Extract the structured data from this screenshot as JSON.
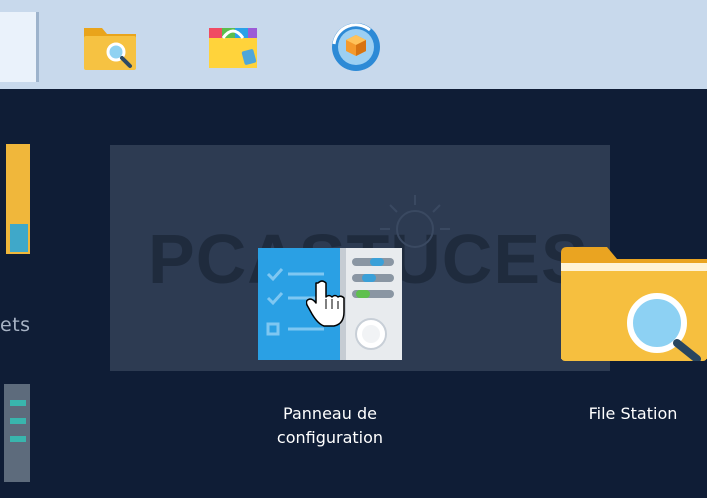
{
  "taskbar": {
    "items": [
      {
        "icon": "file-station-icon"
      },
      {
        "icon": "package-center-icon"
      },
      {
        "icon": "hyper-backup-icon"
      }
    ]
  },
  "desktop": {
    "partial_label": "ets",
    "watermark_text": "PCASTUCES",
    "icons": [
      {
        "icon": "control-panel-icon",
        "label_line1": "Panneau de",
        "label_line2": "configuration"
      },
      {
        "icon": "file-station-icon",
        "label_line1": "File Station"
      }
    ]
  },
  "colors": {
    "desktop_bg": "#0f1d36",
    "taskbar_bg": "#c8d9ec",
    "hover_tile": "#2d3b52",
    "folder_yellow": "#f4bb3a"
  }
}
